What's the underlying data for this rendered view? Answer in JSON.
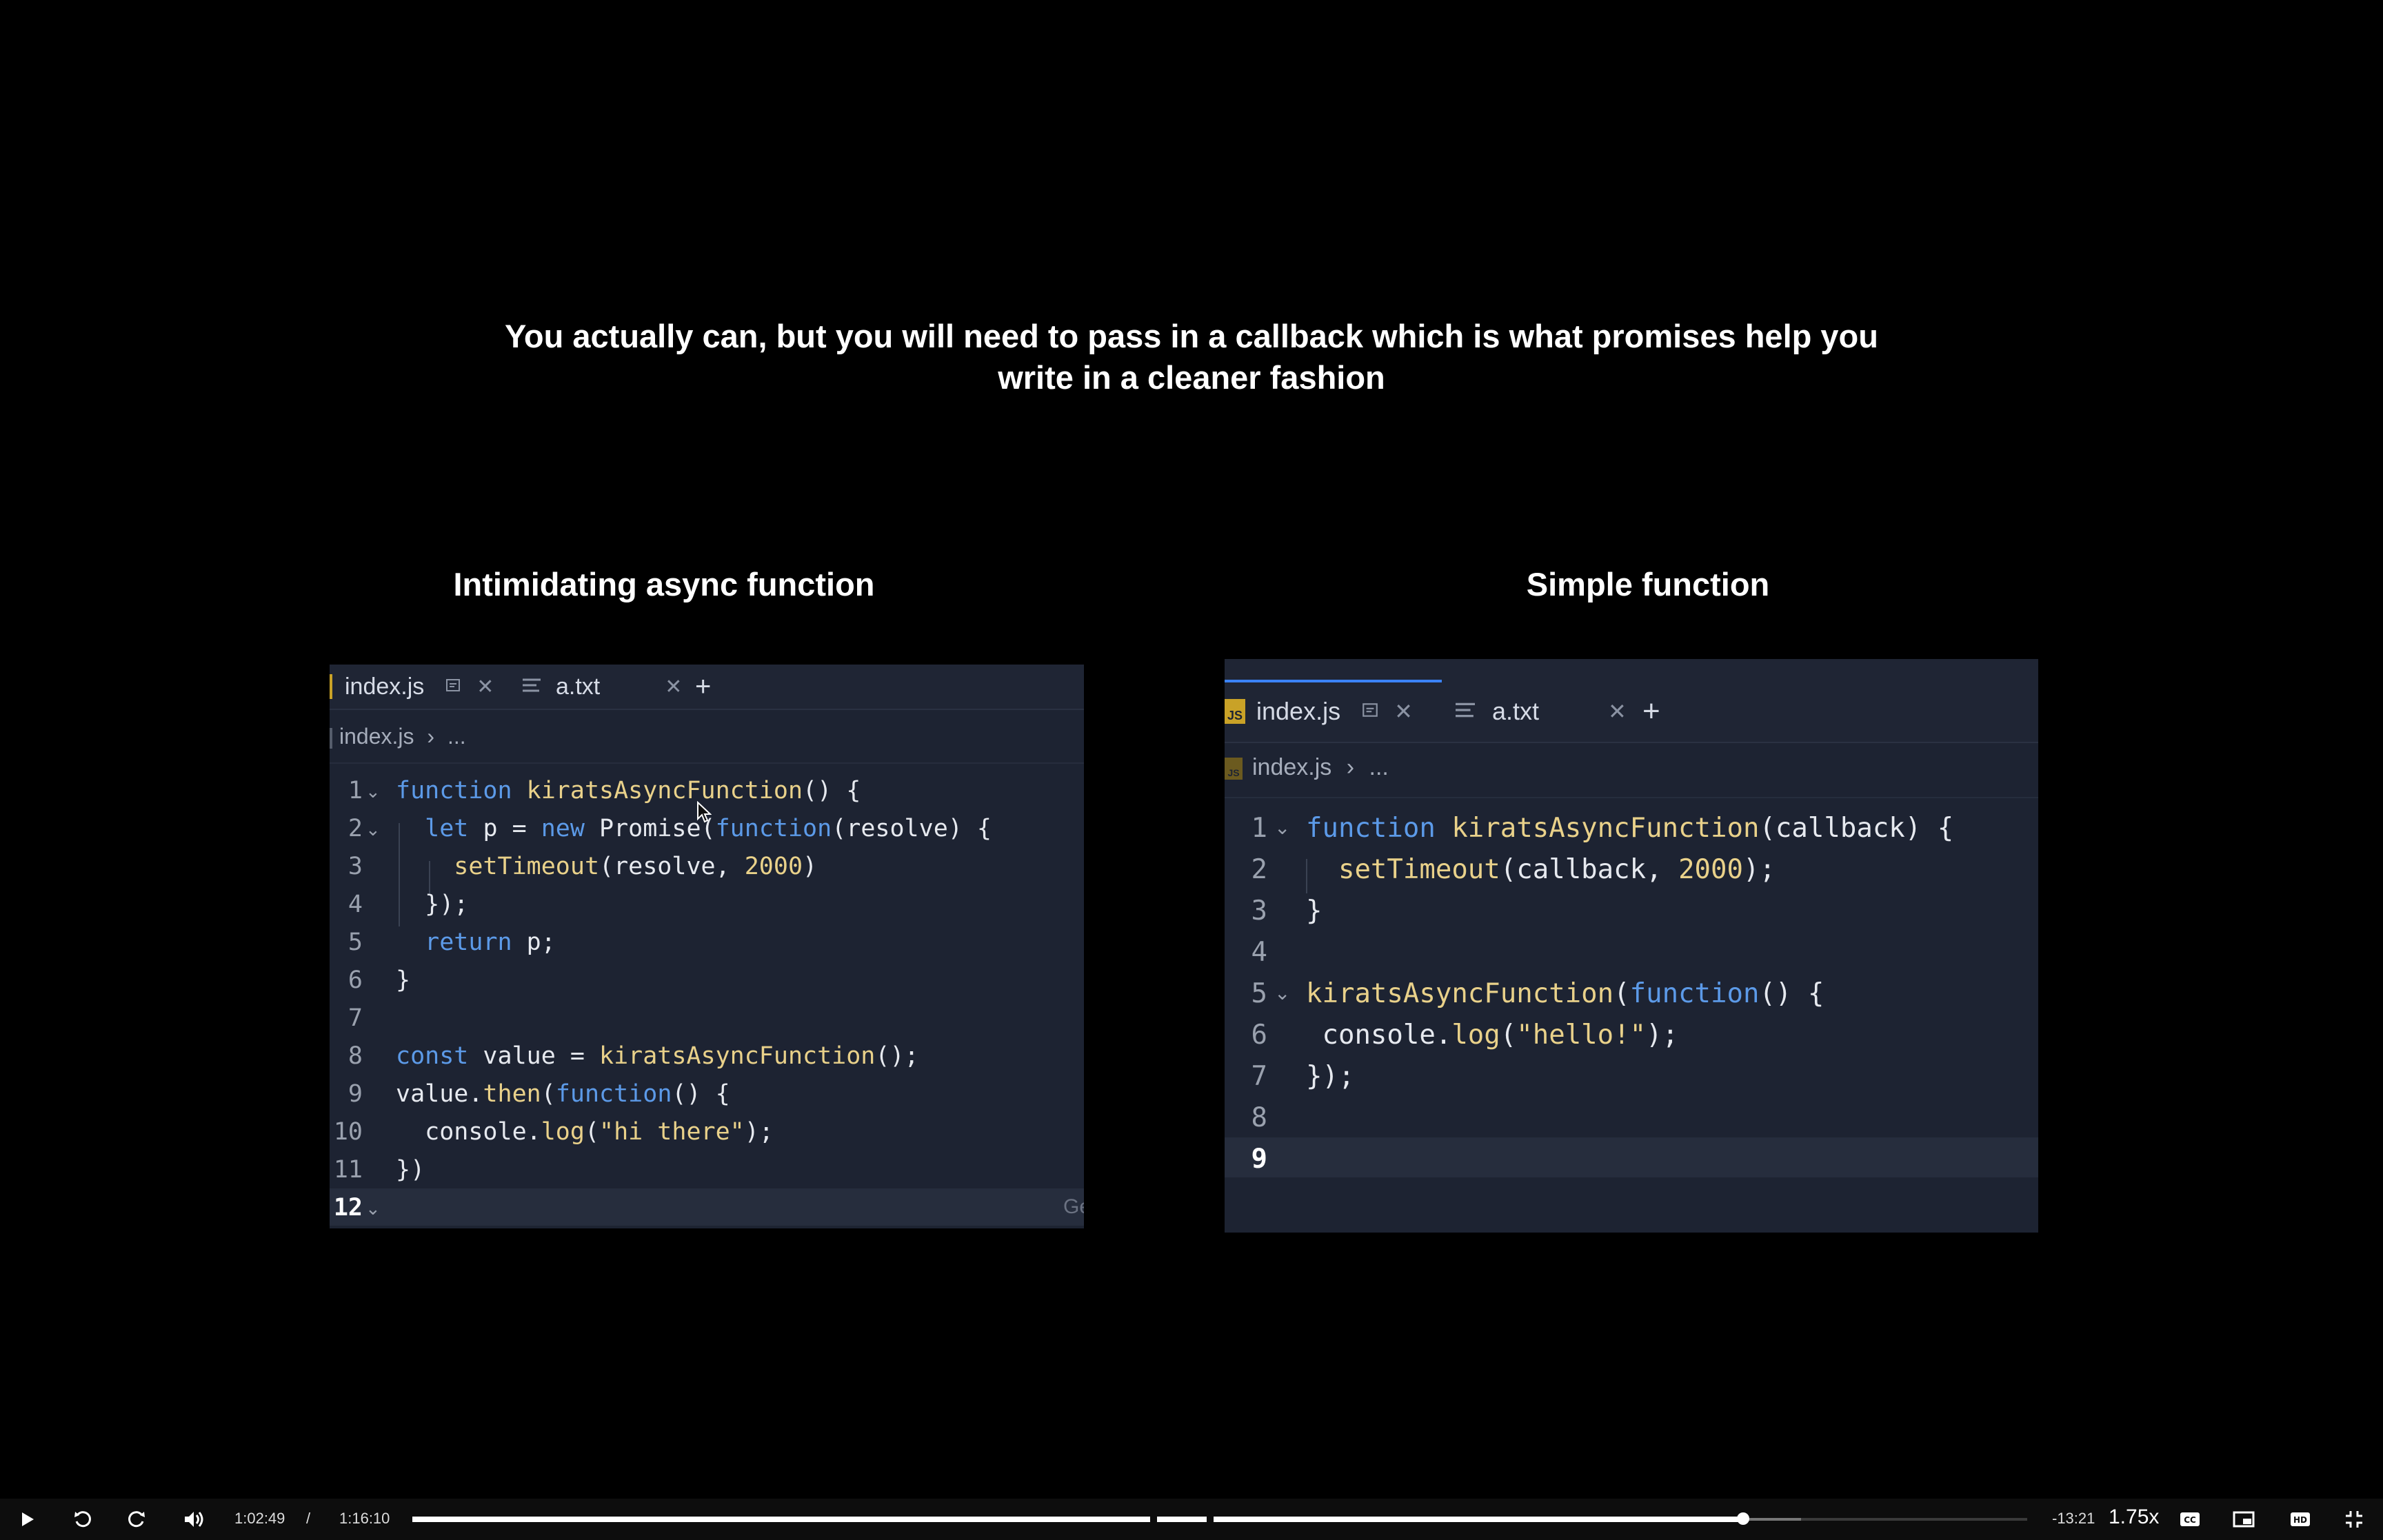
{
  "slide": {
    "heading_line1": "You actually can, but you will need to pass in a callback which is what promises help you",
    "heading_line2": "write in a cleaner fashion",
    "left_label": "Intimidating async function",
    "right_label": "Simple function"
  },
  "left_editor": {
    "tab1": "index.js",
    "tab2": "a.txt",
    "breadcrumb_file": "index.js",
    "breadcrumb_more": "...",
    "line_numbers": [
      "1",
      "2",
      "3",
      "4",
      "5",
      "6",
      "7",
      "8",
      "9",
      "10",
      "11",
      "12"
    ],
    "corner_text": "Ge"
  },
  "right_editor": {
    "tab1": "index.js",
    "tab2": "a.txt",
    "breadcrumb_file": "index.js",
    "breadcrumb_more": "...",
    "line_numbers": [
      "1",
      "2",
      "3",
      "4",
      "5",
      "6",
      "7",
      "8",
      "9"
    ]
  },
  "player": {
    "current_time": "1:02:49",
    "separator": "/",
    "duration": "1:16:10",
    "remaining": "-13:21",
    "speed": "1.75x",
    "progress_fraction": 0.824,
    "buffered_fraction": 0.86
  },
  "colors": {
    "editor_bg": "#1d2332",
    "keyword": "#5c9ae8",
    "function": "#e9d18a",
    "active_tab_accent": "#3b82f6"
  }
}
